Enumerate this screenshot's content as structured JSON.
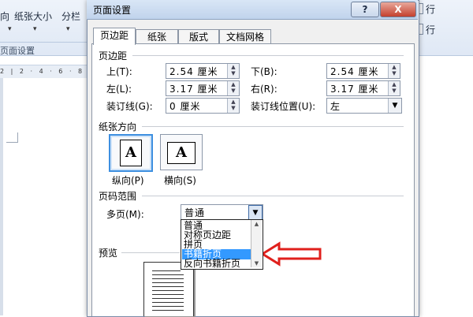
{
  "ribbon": {
    "left_items": [
      "向",
      "纸张大小",
      "分栏"
    ],
    "group_label": "页面设置",
    "ruler_text": "2 | 2 · 4 · 6 · 8 · 1",
    "right_row1": "行",
    "right_row2": "行"
  },
  "dialog": {
    "title": "页面设置",
    "help_label": "?",
    "close_label": "X",
    "tabs": [
      {
        "label": "页边距",
        "active": true
      },
      {
        "label": "纸张"
      },
      {
        "label": "版式"
      },
      {
        "label": "文档网格"
      }
    ],
    "margins": {
      "section_title": "页边距",
      "top_label": "上(T):",
      "top_value": "2.54 厘米",
      "bottom_label": "下(B):",
      "bottom_value": "2.54 厘米",
      "left_label": "左(L):",
      "left_value": "3.17 厘米",
      "right_label": "右(R):",
      "right_value": "3.17 厘米",
      "gutter_label": "装订线(G):",
      "gutter_value": "0 厘米",
      "gutter_pos_label": "装订线位置(U):",
      "gutter_pos_value": "左"
    },
    "orientation": {
      "section_title": "纸张方向",
      "portrait_label": "纵向(P)",
      "landscape_label": "横向(S)",
      "glyph": "A"
    },
    "pages": {
      "section_title": "页码范围",
      "multi_label": "多页(M):",
      "multi_value": "普通",
      "options": [
        "普通",
        "对称页边距",
        "拼页",
        "书籍折页",
        "反向书籍折页"
      ],
      "highlighted_index": 3
    },
    "preview": {
      "section_title": "预览"
    }
  },
  "colors": {
    "highlight": "#3399ff",
    "arrow": "#e0201c",
    "close_button": "#c4402e"
  }
}
